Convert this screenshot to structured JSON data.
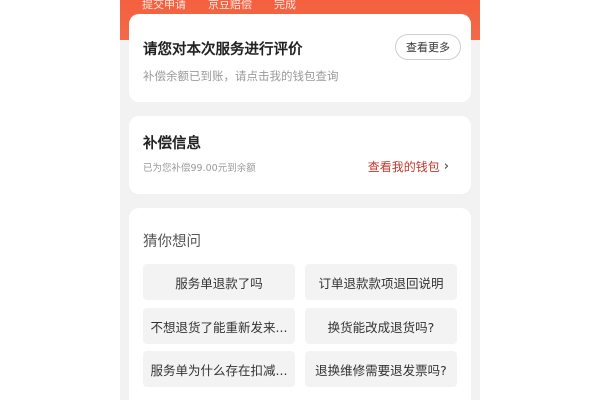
{
  "steps": [
    "提交申请",
    "京豆赔偿",
    "完成"
  ],
  "rate_card": {
    "title": "请您对本次服务进行评价",
    "subtitle": "补偿余额已到账，请点击我的钱包查询",
    "more_label": "查看更多"
  },
  "comp_card": {
    "title": "补偿信息",
    "detail": "已为您补偿99.00元到余额",
    "wallet_label": "查看我的钱包",
    "chevron_icon": "chevron-right-icon",
    "link_color": "#c0392b"
  },
  "faq": {
    "title": "猜你想问",
    "questions": [
      "服务单退款了吗",
      "订单退款款项退回说明",
      "不想退货了能重新发来...",
      "换货能改成退货吗?",
      "服务单为什么存在扣减...",
      "退换维修需要退发票吗?"
    ]
  },
  "colors": {
    "accent": "#f4603f"
  }
}
